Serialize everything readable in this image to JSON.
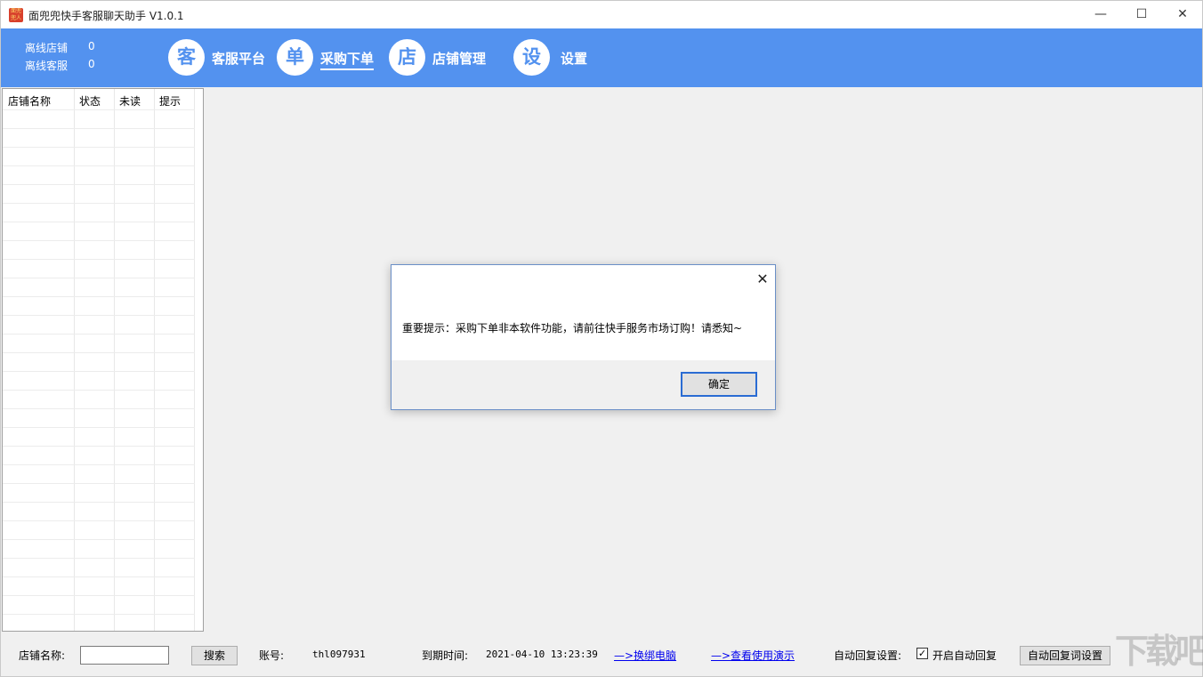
{
  "window": {
    "title": "面兜兜快手客服聊天助手 V1.0.1",
    "icon_text": "面兜兜人",
    "minimize": "—",
    "maximize": "☐",
    "close": "✕"
  },
  "stats": {
    "offline_shops_label": "离线店铺",
    "offline_shops_value": "0",
    "offline_agents_label": "离线客服",
    "offline_agents_value": "0"
  },
  "nav": {
    "items": [
      {
        "glyph": "客",
        "label": "客服平台"
      },
      {
        "glyph": "单",
        "label": "采购下单"
      },
      {
        "glyph": "店",
        "label": "店铺管理"
      },
      {
        "glyph": "设",
        "label": "设置"
      }
    ],
    "active_index": 1
  },
  "shop_table": {
    "columns": [
      "店铺名称",
      "状态",
      "未读",
      "提示"
    ]
  },
  "footer": {
    "shop_name_label": "店铺名称:",
    "shop_name_value": "",
    "search_button": "搜索",
    "account_label": "账号:",
    "account_value": "thl097931",
    "expire_label": "到期时间:",
    "expire_value": "2021-04-10 13:23:39",
    "unbind_link": "—>换绑电脑",
    "demo_link": "—>查看使用演示",
    "auto_reply_label": "自动回复设置:",
    "auto_reply_checkbox_label": "开启自动回复",
    "auto_reply_checked": true,
    "auto_reply_settings_button": "自动回复词设置",
    "checkmark": "✓"
  },
  "watermark": "下载吧",
  "dialog": {
    "message": "重要提示：采购下单非本软件功能，请前往快手服务市场订购！请悉知~",
    "ok_button": "确定",
    "close": "✕"
  },
  "colors": {
    "toolbar": "#5392ef",
    "dialog_focus": "#2a6cd3"
  }
}
